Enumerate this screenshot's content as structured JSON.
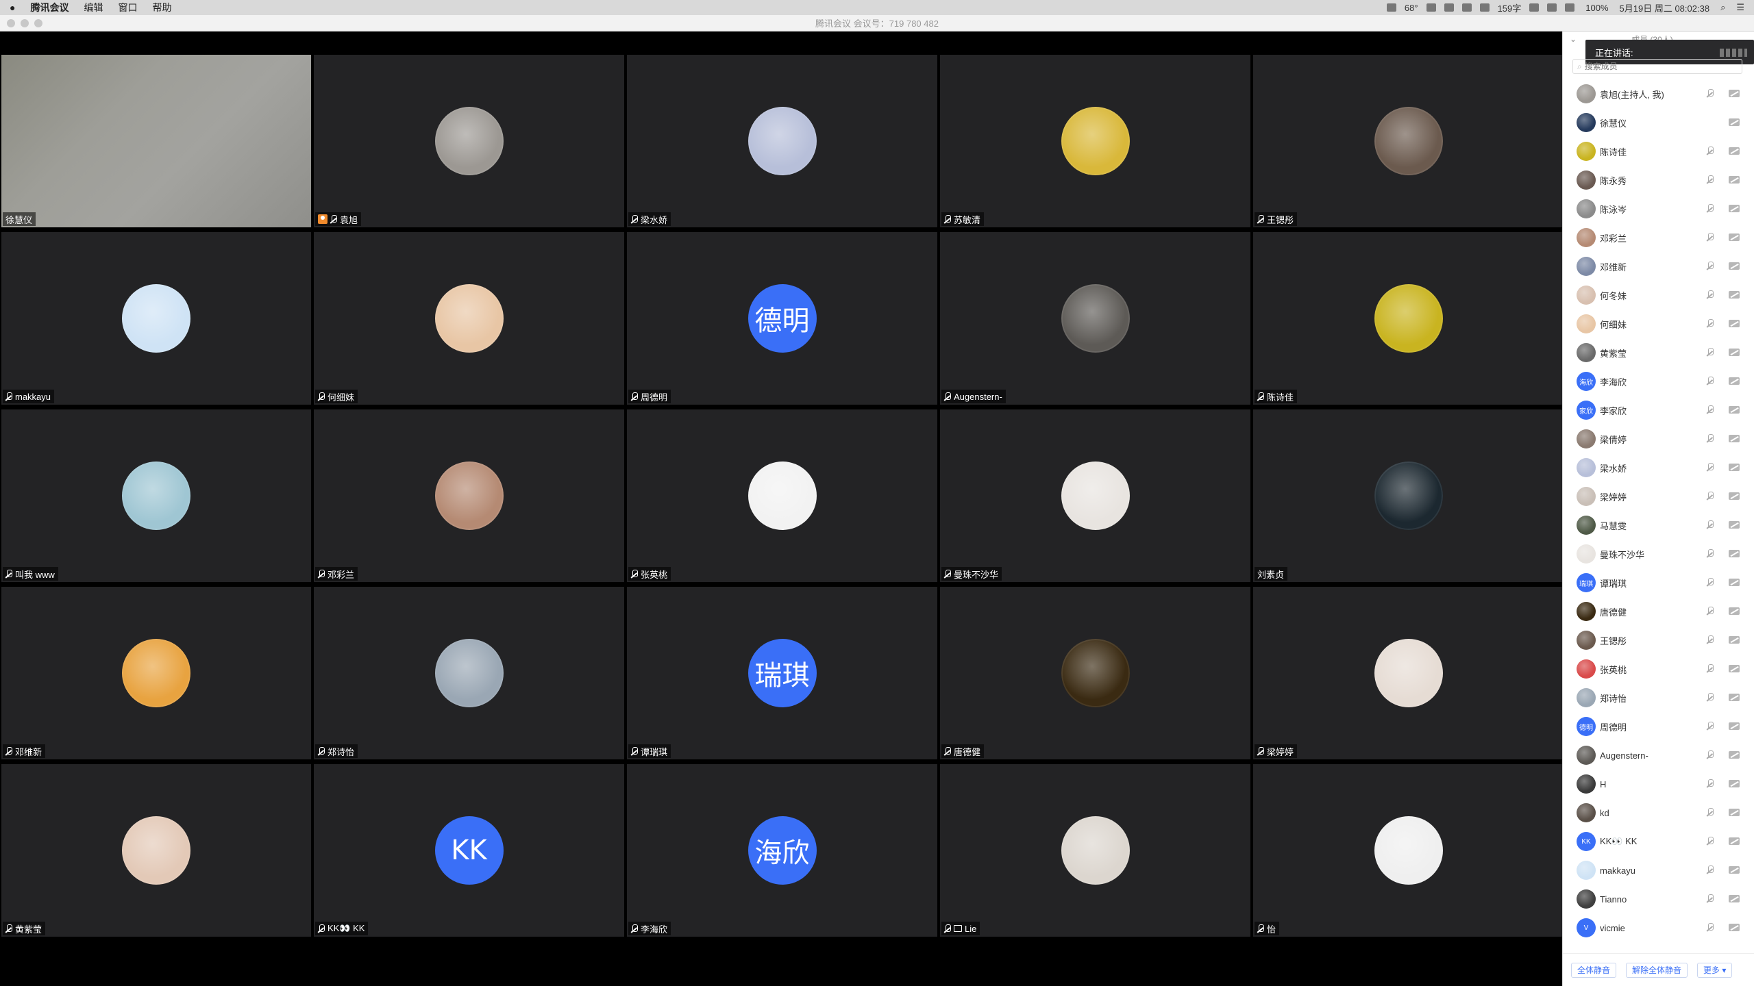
{
  "menubar": {
    "apple": "",
    "app_name": "腾讯会议",
    "menus": [
      "编辑",
      "窗口",
      "帮助"
    ],
    "temperature": "68°",
    "word_count": "159字",
    "battery": "100%",
    "datetime": "5月19日 周二 08:02:38"
  },
  "window": {
    "title": "腾讯会议 会议号：719 780 482"
  },
  "colors": {
    "tile_bg": "#232325",
    "text_avatar": "#3a6ff7",
    "host_badge": "#f08a2c"
  },
  "tiles": [
    {
      "name": "徐慧仪",
      "type": "video",
      "muted": false,
      "host": false
    },
    {
      "name": "袁旭",
      "type": "pic",
      "color": "#9c9893",
      "muted": true,
      "host": true
    },
    {
      "name": "梁水娇",
      "type": "pic",
      "color": "#b7bfd9",
      "muted": true
    },
    {
      "name": "苏敏清",
      "type": "pic",
      "color": "#d9b83a",
      "muted": true
    },
    {
      "name": "王锶彤",
      "type": "pic",
      "color": "#6b5a4e",
      "muted": true
    },
    {
      "name": "makkayu",
      "type": "pic",
      "color": "#cfe3f5",
      "muted": true
    },
    {
      "name": "何细妹",
      "type": "pic",
      "color": "#e8c6a5",
      "muted": true
    },
    {
      "name": "周德明",
      "type": "text",
      "avatar_text": "德明",
      "muted": true
    },
    {
      "name": "Augenstern-",
      "type": "pic",
      "color": "#5d5a56",
      "muted": true
    },
    {
      "name": "陈诗佳",
      "type": "pic",
      "color": "#c9b420",
      "muted": true
    },
    {
      "name": "叫我 www",
      "type": "pic",
      "color": "#9fc6d3",
      "muted": true
    },
    {
      "name": "邓彩兰",
      "type": "pic",
      "color": "#b58a73",
      "muted": true
    },
    {
      "name": "张英桃",
      "type": "pic",
      "color": "#f2f2f2",
      "muted": true
    },
    {
      "name": "曼珠不沙华",
      "type": "pic",
      "color": "#e8e4e0",
      "muted": true
    },
    {
      "name": "刘素贞",
      "type": "pic",
      "color": "#1c2830",
      "muted": false
    },
    {
      "name": "邓维新",
      "type": "pic",
      "color": "#e8a340",
      "muted": true
    },
    {
      "name": "郑诗怡",
      "type": "pic",
      "color": "#9aa7b4",
      "muted": true
    },
    {
      "name": "谭瑞琪",
      "type": "text",
      "avatar_text": "瑞琪",
      "muted": true
    },
    {
      "name": "唐德健",
      "type": "pic",
      "color": "#3a2a12",
      "muted": true
    },
    {
      "name": "梁婷婷",
      "type": "pic",
      "color": "#e6dcd4",
      "muted": true
    },
    {
      "name": "黄紫莹",
      "type": "pic",
      "color": "#e3c9b7",
      "muted": true
    },
    {
      "name": "KK👀 KK",
      "type": "text",
      "avatar_text": "KK",
      "muted": true
    },
    {
      "name": "李海欣",
      "type": "text",
      "avatar_text": "海欣",
      "muted": true
    },
    {
      "name": "Lie",
      "type": "pic",
      "color": "#dcd6cf",
      "muted": true,
      "screen": true
    },
    {
      "name": "怡",
      "type": "pic",
      "color": "#efefef",
      "muted": true
    }
  ],
  "panel": {
    "header": "成员 (30人)",
    "speaking_label": "正在讲话:",
    "search_placeholder": "搜索成员",
    "members": [
      {
        "name": "袁旭(主持人, 我)",
        "color": "#9c9893"
      },
      {
        "name": "徐慧仪",
        "color": "#253a5c"
      },
      {
        "name": "陈诗佳",
        "color": "#c9b420"
      },
      {
        "name": "陈永秀",
        "color": "#6a5a52"
      },
      {
        "name": "陈泳岑",
        "color": "#8b8b8b"
      },
      {
        "name": "邓彩兰",
        "color": "#b58a73"
      },
      {
        "name": "邓维新",
        "color": "#7d8aa6"
      },
      {
        "name": "何冬妹",
        "color": "#d8c0b0"
      },
      {
        "name": "何细妹",
        "color": "#e8c6a5"
      },
      {
        "name": "黄紫莹",
        "color": "#6a6a6a"
      },
      {
        "name": "李海欣",
        "avatar_text": "海欣"
      },
      {
        "name": "李家欣",
        "avatar_text": "家欣"
      },
      {
        "name": "梁倩婷",
        "color": "#8a7a70"
      },
      {
        "name": "梁水娇",
        "color": "#b7bfd9"
      },
      {
        "name": "梁婷婷",
        "color": "#c9bfb7"
      },
      {
        "name": "马慧雯",
        "color": "#4f5a47"
      },
      {
        "name": "曼珠不沙华",
        "color": "#e8e4e0"
      },
      {
        "name": "谭瑞琪",
        "avatar_text": "瑞琪"
      },
      {
        "name": "唐德健",
        "color": "#3a2a12"
      },
      {
        "name": "王锶彤",
        "color": "#6b5a4e"
      },
      {
        "name": "张英桃",
        "color": "#d94a4a"
      },
      {
        "name": "郑诗怡",
        "color": "#9aa7b4"
      },
      {
        "name": "周德明",
        "avatar_text": "德明"
      },
      {
        "name": "Augenstern-",
        "color": "#5d5a56"
      },
      {
        "name": "H",
        "color": "#3a3a3a"
      },
      {
        "name": "kd",
        "color": "#5a5048"
      },
      {
        "name": "KK👀 KK",
        "avatar_text": "KK"
      },
      {
        "name": "makkayu",
        "color": "#cfe3f5"
      },
      {
        "name": "Tianno",
        "color": "#3f3f3f"
      },
      {
        "name": "vicmie",
        "avatar_text": "V"
      }
    ],
    "buttons": {
      "mute_all": "全体静音",
      "unmute_all": "解除全体静音",
      "more": "更多 ▾"
    }
  }
}
